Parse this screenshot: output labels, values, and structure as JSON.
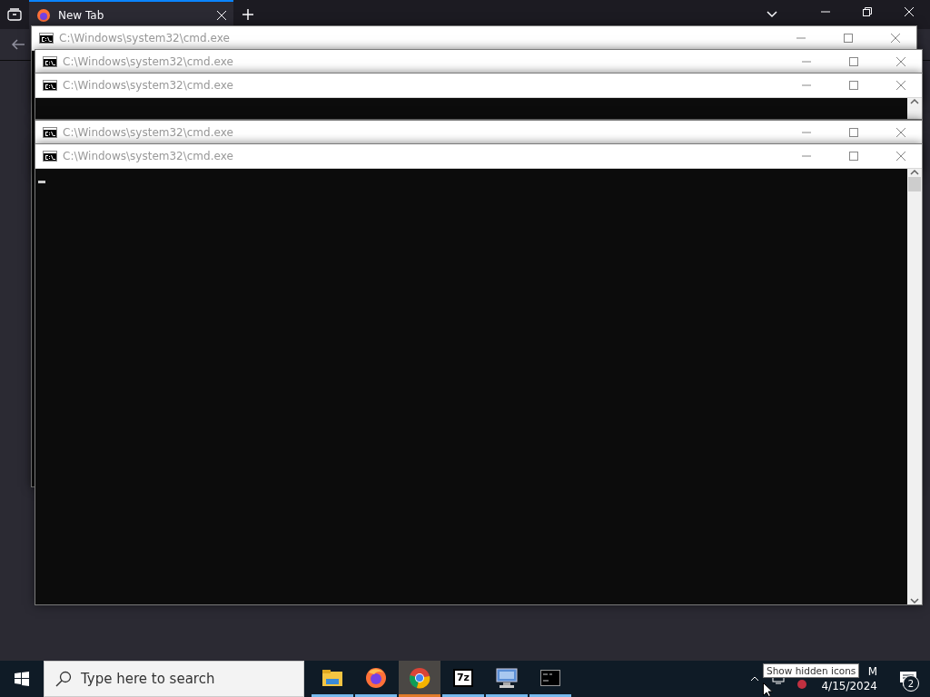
{
  "browser": {
    "tabs": [
      {
        "title": "New Tab",
        "selected": true
      }
    ]
  },
  "console_windows": [
    {
      "title": "C:\\Windows\\system32\\cmd.exe",
      "active": false
    },
    {
      "title": "C:\\Windows\\system32\\cmd.exe",
      "active": false
    },
    {
      "title": "C:\\Windows\\system32\\cmd.exe",
      "active": false
    },
    {
      "title": "C:\\Windows\\system32\\cmd.exe",
      "active": false
    },
    {
      "title": "C:\\Windows\\system32\\cmd.exe",
      "active": false
    }
  ],
  "taskbar": {
    "search": {
      "placeholder": "Type here to search"
    },
    "apps": [
      {
        "kind": "explorer",
        "selected": false
      },
      {
        "kind": "firefox",
        "selected": false
      },
      {
        "kind": "chrome",
        "selected": true
      },
      {
        "kind": "archiver",
        "label": "7z",
        "selected": false
      },
      {
        "kind": "network",
        "selected": false
      },
      {
        "kind": "console",
        "selected": false
      }
    ],
    "tooltip": "Show hidden icons",
    "clock": {
      "time": "M",
      "date": "4/15/2024"
    },
    "notifications": {
      "count": "2"
    }
  }
}
